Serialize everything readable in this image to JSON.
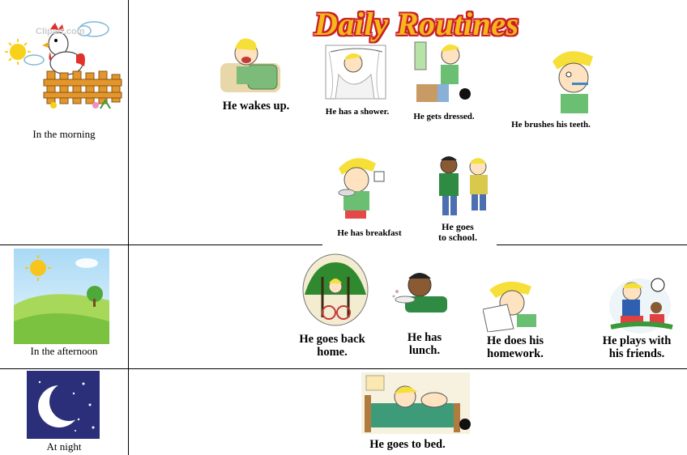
{
  "title": "Daily Routines",
  "periods": {
    "morning": "In the morning",
    "afternoon": "In the afternoon",
    "night": "At night"
  },
  "watermark": "Clipart.com",
  "activities": {
    "wakes_up": "He wakes up.",
    "shower": "He has a shower.",
    "dressed": "He gets dressed.",
    "teeth": "He brushes his teeth.",
    "breakfast": "He has breakfast",
    "school_line1": "He goes",
    "school_line2": "to school.",
    "back_home_line1": "He goes back",
    "back_home_line2": "home.",
    "lunch_line1": "He has",
    "lunch_line2": "lunch.",
    "homework_line1": "He does his",
    "homework_line2": "homework.",
    "plays_line1": "He plays with",
    "plays_line2": "his friends.",
    "bed": "He goes to bed."
  },
  "colors": {
    "title_fill": "#f6b71a",
    "title_outline": "#c8202a",
    "night_sky": "#2b2f7a",
    "hair": "#f7df3a",
    "shirt": "#3a9a3a"
  }
}
